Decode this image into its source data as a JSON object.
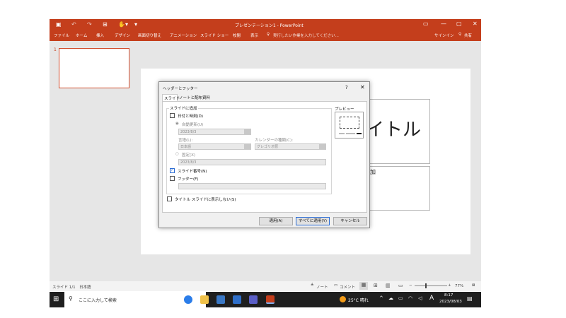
{
  "app": {
    "title": "プレゼンテーション1 - PowerPoint",
    "tabs": [
      "ファイル",
      "ホーム",
      "挿入",
      "デザイン",
      "画面切り替え",
      "アニメーション",
      "スライド ショー",
      "校閲",
      "表示"
    ],
    "tell_me": "実行したい作業を入力してください...",
    "signin": "サインイン",
    "share": "共有"
  },
  "slide_pane": {
    "thumb_number": "1"
  },
  "slide": {
    "title_text": "イトル",
    "subtitle_text": "加"
  },
  "dialog": {
    "title": "ヘッダーとフッター",
    "help": "?",
    "close": "✕",
    "tabs": [
      "スライド",
      "ノートと配布資料"
    ],
    "group_label": "スライドに追加",
    "date_time": "日付と時刻(D)",
    "auto_update": "自動更新(U)",
    "auto_date": "2023/8/3",
    "language_label": "言語(L):",
    "language_value": "日本語",
    "calendar_label": "カレンダーの種類(C):",
    "calendar_value": "グレゴリオ暦",
    "fixed": "固定(X)",
    "fixed_value": "2023/8/3",
    "slide_number": "スライド番号(N)",
    "footer": "フッター(F)",
    "footer_value": "",
    "hide_title": "タイトル スライドに表示しない(S)",
    "preview_label": "プレビュー",
    "apply": "適用(A)",
    "apply_all": "すべてに適用(Y)",
    "cancel": "キャンセル"
  },
  "status": {
    "slide_info": "スライド 1/1",
    "language": "日本語",
    "notes": "ノート",
    "comments": "コメント",
    "zoom": "77%"
  },
  "taskbar": {
    "search_placeholder": "ここに入力して検索",
    "weather": "25°C  晴れ",
    "ime": "A",
    "time": "8:17",
    "date": "2023/08/03"
  },
  "colors": {
    "accent": "#c43e1c",
    "taskbar": "#1f1f1f",
    "select_blue": "#2b6cd4"
  }
}
